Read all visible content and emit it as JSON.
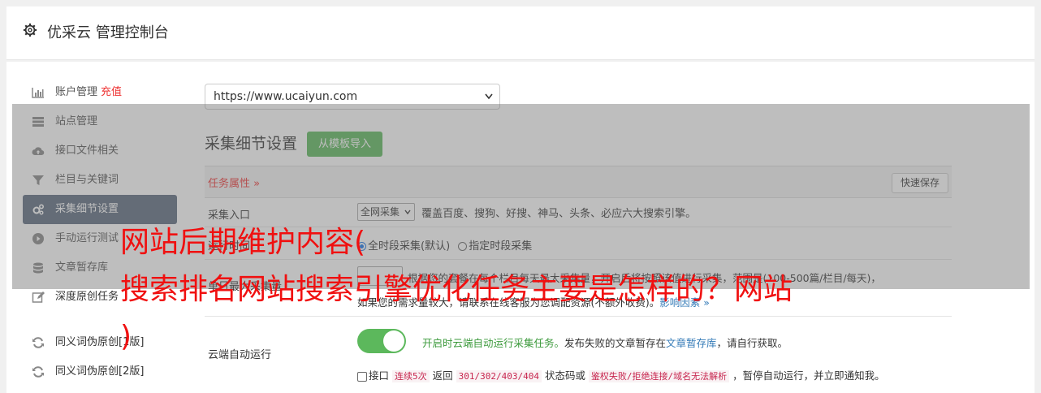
{
  "header": {
    "title": "优采云 管理控制台",
    "icon": "gear-icon"
  },
  "sidebar": {
    "items": [
      {
        "label": "账户管理",
        "extra": "充值",
        "icon": "bar-chart-icon"
      },
      {
        "label": "站点管理",
        "icon": "server-icon"
      },
      {
        "label": "接口文件相关",
        "icon": "cloud-upload-icon"
      },
      {
        "label": "栏目与关键词",
        "icon": "filter-icon"
      },
      {
        "label": "采集细节设置",
        "icon": "gears-icon",
        "active": true
      },
      {
        "label": "手动运行测试",
        "icon": "play-icon"
      },
      {
        "label": "文章暂存库",
        "icon": "database-icon"
      },
      {
        "label": "深度原创任务",
        "icon": "edit-icon"
      },
      {
        "label": "同义词伪原创[1版]",
        "icon": "refresh-icon"
      },
      {
        "label": "同义词伪原创[2版]",
        "icon": "refresh-icon"
      }
    ]
  },
  "site_select": {
    "value": "https://www.ucaiyun.com"
  },
  "section": {
    "title": "采集细节设置",
    "import_button": "从模板导入"
  },
  "attr_bar": {
    "label": "任务属性 »",
    "save_button": "快速保存"
  },
  "rows": {
    "entry": {
      "label": "采集入口",
      "select_value": "全网采集",
      "desc": "覆盖百度、搜狗、好搜、神马、头条、必应六大搜索引擎。"
    },
    "period": {
      "label": "运行时间",
      "option1": "全时段采集(默认)",
      "option2": "指定时段采集"
    },
    "max": {
      "label": "单日最大采集量",
      "line1": "根据您的套餐在每个栏目每天最大采集量，开启后将按照该值进行采集，范围是(100-500篇/栏目/每天)，",
      "line2": "如果您的需求量较大，请联系在线客服为您调配资源(不额外收费)。",
      "link": "影响因素 »"
    },
    "cloud": {
      "label": "云端自动运行",
      "green_text": "开启时云端自动运行采集任务。",
      "desc1": "发布失败的文章暂存在",
      "link": "文章暂存库",
      "desc2": "，请自行获取。",
      "chk_label": "接口",
      "code1": "连续5次",
      "t1": "返回",
      "code2": "301/302/403/404",
      "t2": "状态码或",
      "code3": "鉴权失败/拒绝连接/域名无法解析",
      "t3": "，暂停自动运行，并立即通知我。"
    }
  },
  "overlay": {
    "line1": "网站后期维护内容(",
    "line2": "搜索排名网站搜索引擎优化任务主要是怎样的？网站",
    "line3": ")"
  }
}
